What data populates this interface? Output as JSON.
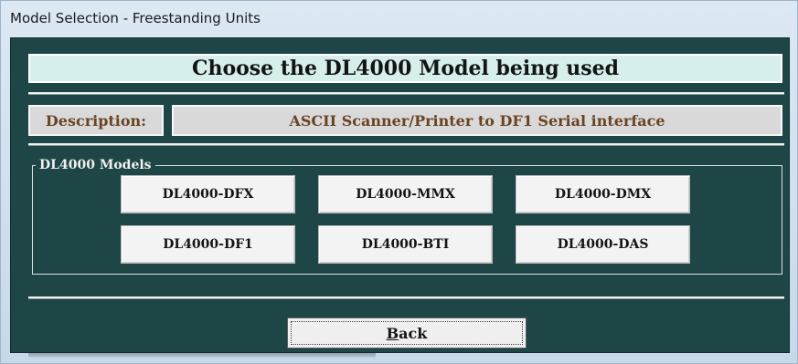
{
  "window": {
    "title": "Model Selection - Freestanding Units"
  },
  "header": {
    "title": "Choose the DL4000 Model being used"
  },
  "description": {
    "label": "Description:",
    "value": "ASCII Scanner/Printer to DF1 Serial interface"
  },
  "models_group": {
    "legend": "DL4000 Models",
    "buttons": [
      "DL4000-DFX",
      "DL4000-MMX",
      "DL4000-DMX",
      "DL4000-DF1",
      "DL4000-BTI",
      "DL4000-DAS"
    ]
  },
  "footer": {
    "back_label_mnemonic": "B",
    "back_label_rest": "ack"
  },
  "colors": {
    "client_background": "#1f4646",
    "header_background": "#d6efec",
    "description_text": "#6a4423",
    "field_background": "#d9d9d9"
  }
}
